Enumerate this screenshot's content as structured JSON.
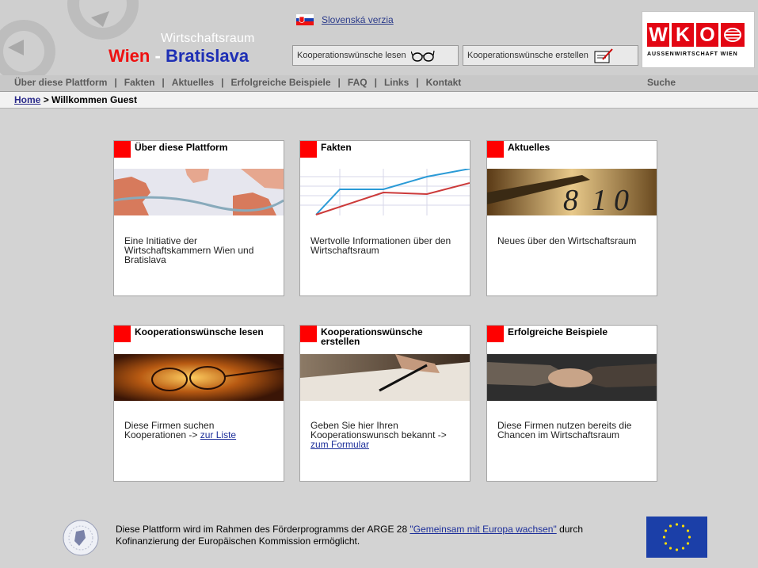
{
  "header": {
    "brand_subtitle": "Wirtschaftsraum",
    "brand_city1": "Wien",
    "brand_separator": "-",
    "brand_city2": "Bratislava",
    "language_link": "Slovenská verzia",
    "btn_read": "Kooperationswünsche lesen",
    "btn_create": "Kooperationswünsche erstellen",
    "logo_letters": [
      "W",
      "K",
      "O"
    ],
    "logo_tagline": "AUSSENWIRTSCHAFT WIEN"
  },
  "nav": {
    "items": [
      "Über diese Plattform",
      "Fakten",
      "Aktuelles",
      "Erfolgreiche Beispiele",
      "FAQ",
      "Links",
      "Kontakt"
    ],
    "search": "Suche"
  },
  "breadcrumb": {
    "home": "Home",
    "separator": ">",
    "current": "Willkommen Guest"
  },
  "tiles": [
    {
      "title": "Über diese Plattform",
      "desc": "Eine Initiative der Wirtschaftskammern Wien und Bratislava",
      "link": ""
    },
    {
      "title": "Fakten",
      "desc": "Wertvolle Informationen über den Wirtschaftsraum",
      "link": ""
    },
    {
      "title": "Aktuelles",
      "desc": "Neues über den Wirtschaftsraum",
      "link": ""
    },
    {
      "title": "Kooperationswünsche lesen",
      "desc": "Diese Firmen suchen Kooperationen ->",
      "link": "zur Liste"
    },
    {
      "title": "Kooperationswünsche erstellen",
      "desc": "Geben Sie hier Ihren Kooperationswunsch bekannt ->",
      "link": "zum Formular"
    },
    {
      "title": "Erfolgreiche Beispiele",
      "desc": "Diese Firmen nutzen bereits die Chancen im Wirtschaftsraum",
      "link": ""
    }
  ],
  "footer": {
    "text_before": "Diese Plattform wird im Rahmen des Förderprogramms der ARGE 28 ",
    "link": "\"Gemeinsam mit Europa wachsen\"",
    "text_after": " durch Kofinanzierung der Europäischen Kommission ermöglicht."
  },
  "colors": {
    "accent_red": "#ff0000",
    "brand_blue": "#1e2fb5",
    "link_blue": "#1d2f9a",
    "background": "#d3d3d3"
  },
  "icons": [
    "flag-slovakia-icon",
    "glasses-icon",
    "write-icon",
    "arge28-logo",
    "eu-flag-icon"
  ]
}
